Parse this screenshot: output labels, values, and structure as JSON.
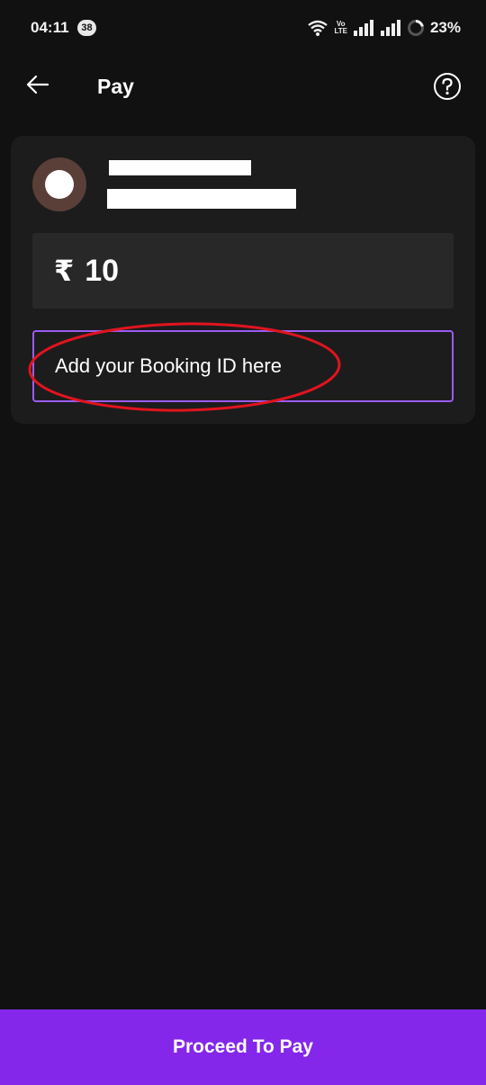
{
  "status_bar": {
    "time": "04:11",
    "notification_count": "38",
    "network_label_top": "Vo",
    "network_label_bottom": "LTE",
    "battery_percent": "23%"
  },
  "header": {
    "title": "Pay",
    "back_icon": "arrow-left-icon",
    "help_icon": "question-circle-icon"
  },
  "payee": {
    "avatar_icon": "avatar-circle-icon"
  },
  "amount": {
    "currency_symbol": "₹",
    "value": "10"
  },
  "booking_id": {
    "placeholder": "Add your Booking ID here"
  },
  "footer": {
    "proceed_label": "Proceed To Pay"
  },
  "colors": {
    "background": "#111111",
    "card": "#1c1c1c",
    "accent": "#8427ea",
    "input_border": "#9a5cf0",
    "annotation": "#e0141e"
  }
}
